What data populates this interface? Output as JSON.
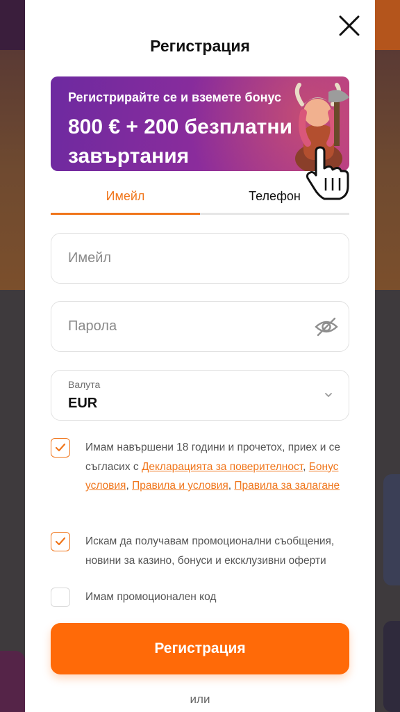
{
  "modal": {
    "title": "Регистрация",
    "close_icon": "close-icon"
  },
  "banner": {
    "subtitle": "Регистрирайте се и вземете бонус",
    "headline": "800 € + 200 безплатни завъртания"
  },
  "tabs": [
    {
      "label": "Имейл",
      "active": true
    },
    {
      "label": "Телефон",
      "active": false
    }
  ],
  "form": {
    "email_placeholder": "Имейл",
    "password_placeholder": "Парола",
    "password_icon": "eye-off-icon",
    "currency_label": "Валута",
    "currency_value": "EUR"
  },
  "consents": {
    "age": {
      "checked": true,
      "text_before": "Имам навършени 18 години и прочетох, приех и се съгласих с ",
      "link_privacy": "Декларацията за поверителност",
      "link_bonus": "Бонус условия",
      "link_terms": "Правила и условия",
      "link_betting": "Правила за залагане",
      "sep": ", "
    },
    "promo_messages": {
      "checked": true,
      "text": "Искам да получавам промоционални съобщения, новини за казино, бонуси и ексклузивни оферти"
    },
    "promo_code": {
      "checked": false,
      "text": "Имам промоционален код"
    }
  },
  "submit_label": "Регистрация",
  "or_label": "или",
  "colors": {
    "accent": "#f0761c",
    "button": "#ff6a08",
    "banner": "#8a2c9c"
  }
}
